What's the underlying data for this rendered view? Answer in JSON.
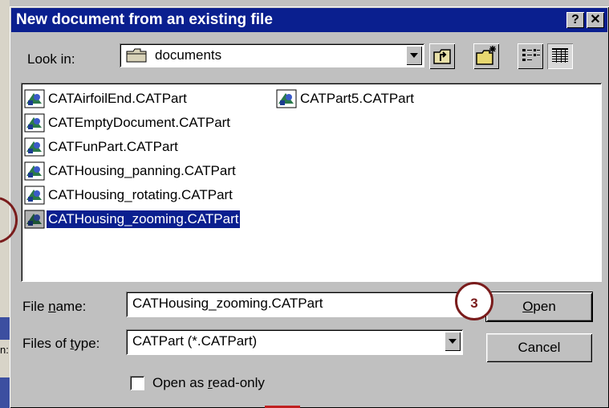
{
  "window": {
    "title": "New document from an existing file",
    "help_label": "?",
    "close_label": "✕"
  },
  "lookin": {
    "label": "Look in:",
    "value": "documents"
  },
  "toolbar": {
    "up_icon": "up-one-level-icon",
    "newfolder_icon": "new-folder-icon",
    "list_icon": "list-view-icon",
    "details_icon": "details-view-icon"
  },
  "files": [
    {
      "name": "CATAirfoilEnd.CATPart",
      "selected": false
    },
    {
      "name": "CATEmptyDocument.CATPart",
      "selected": false
    },
    {
      "name": "CATFunPart.CATPart",
      "selected": false
    },
    {
      "name": "CATHousing_panning.CATPart",
      "selected": false
    },
    {
      "name": "CATHousing_rotating.CATPart",
      "selected": false
    },
    {
      "name": "CATHousing_zooming.CATPart",
      "selected": true
    },
    {
      "name": "CATPart5.CATPart",
      "selected": false
    }
  ],
  "filename": {
    "label": "File name:",
    "value": "CATHousing_zooming.CATPart"
  },
  "filetype": {
    "label": "Files of type:",
    "value": "CATPart (*.CATPart)"
  },
  "buttons": {
    "open": "Open",
    "cancel": "Cancel"
  },
  "readonly": {
    "label": "Open as read-only",
    "checked": false
  },
  "callout": {
    "step": "3"
  },
  "left_strip_text": "n:",
  "colors": {
    "titlebar": "#0a1f8f",
    "selection": "#0a1f8f",
    "callout_border": "#7a1c1c"
  }
}
